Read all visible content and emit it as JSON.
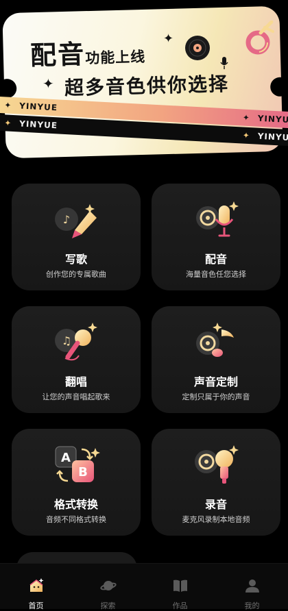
{
  "banner": {
    "title_big": "配音",
    "title_small": "功能上线",
    "subtitle": "超多音色供你选择",
    "stripe_text": "YINYUE",
    "colors": {
      "ticket": "#fbf6df",
      "stripe_gradient_start": "#f7d993",
      "stripe_gradient_end": "#e56986",
      "ink": "#141414"
    }
  },
  "features": [
    {
      "title": "写歌",
      "desc": "创作您的专属歌曲",
      "icon": "music-pen-icon"
    },
    {
      "title": "配音",
      "desc": "海量音色任您选择",
      "icon": "disc-microphone-icon"
    },
    {
      "title": "翻唱",
      "desc": "让您的声音唱起歌来",
      "icon": "music-karaoke-mic-icon"
    },
    {
      "title": "声音定制",
      "desc": "定制只属于你的声音",
      "icon": "disc-music-note-icon"
    },
    {
      "title": "格式转换",
      "desc": "音频不同格式转换",
      "icon": "format-convert-ab-icon"
    },
    {
      "title": "录音",
      "desc": "麦克风录制本地音频",
      "icon": "disc-recorder-mic-icon"
    }
  ],
  "tabbar": {
    "items": [
      {
        "label": "首页",
        "icon": "home-icon",
        "active": true
      },
      {
        "label": "探索",
        "icon": "planet-icon",
        "active": false
      },
      {
        "label": "作品",
        "icon": "book-icon",
        "active": false
      },
      {
        "label": "我的",
        "icon": "profile-icon",
        "active": false
      }
    ]
  },
  "colors": {
    "background": "#000000",
    "card": "#1b1b1b",
    "accent_gold": "#f5c978",
    "accent_pink": "#e56986",
    "tab_inactive": "#707070"
  }
}
